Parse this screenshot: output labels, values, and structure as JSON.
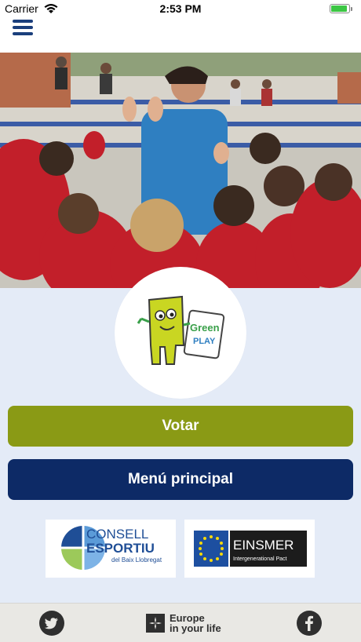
{
  "status_bar": {
    "carrier": "Carrier",
    "time": "2:53 PM",
    "battery_level": 0.9
  },
  "header": {
    "menu_icon": "hamburger-menu-icon"
  },
  "logo": {
    "text_top": "Green",
    "text_bottom": "PLAY"
  },
  "buttons": {
    "votar": "Votar",
    "menu_principal": "Menú principal"
  },
  "sponsors": {
    "consell": {
      "line1": "CONSELL",
      "line2": "ESPORTIU",
      "line3": "del Baix Llobregat"
    },
    "einsmer": {
      "name": "EINSMER",
      "tagline": "Intergenerational Pact"
    }
  },
  "footer": {
    "twitter_icon": "twitter-icon",
    "facebook_icon": "facebook-icon",
    "europe_line1": "Europe",
    "europe_line2": "in your life"
  },
  "colors": {
    "accent_green": "#8a9a15",
    "navy": "#0d2a66",
    "background": "#e4ebf7",
    "footer_bg": "#e9e8e4"
  }
}
